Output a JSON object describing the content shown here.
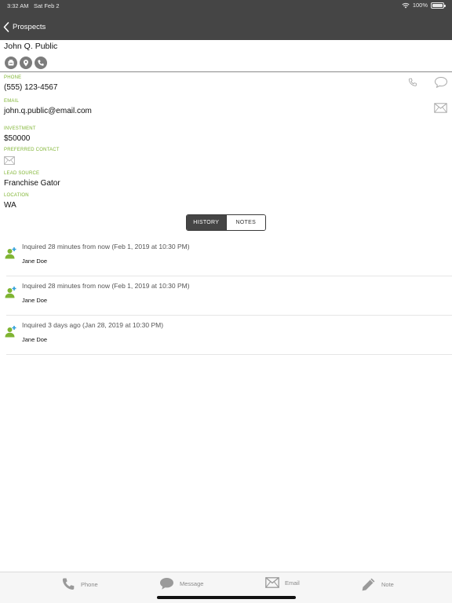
{
  "status_bar": {
    "time": "3:32 AM",
    "date": "Sat Feb 2",
    "battery": "100%",
    "battery_level": 1.0
  },
  "nav": {
    "back_label": "Prospects"
  },
  "contact": {
    "name": "John Q. Public",
    "fields": [
      {
        "label": "PHONE",
        "value": "(555) 123-4567"
      },
      {
        "label": "EMAIL",
        "value": "john.q.public@email.com"
      },
      {
        "label": "INVESTMENT",
        "value": "$50000"
      },
      {
        "label": "PREFERRED CONTACT",
        "icon": "envelope-icon"
      },
      {
        "label": "LEAD SOURCE",
        "value": "Franchise Gator"
      },
      {
        "label": "LOCATION",
        "value": "WA"
      }
    ]
  },
  "segments": {
    "history": "HISTORY",
    "notes": "NOTES",
    "selected": "HISTORY"
  },
  "history": [
    {
      "text": "Inquired 28 minutes from now (Feb 1, 2019 at 10:30 PM)",
      "person": "Jane Doe",
      "icon": "add-person-icon"
    },
    {
      "text": "Inquired 28 minutes from now (Feb 1, 2019 at 10:30 PM)",
      "person": "Jane Doe",
      "icon": "add-person-icon"
    },
    {
      "text": "Inquired 3 days ago (Jan 28, 2019 at 10:30 PM)",
      "person": "Jane Doe",
      "icon": "add-person-icon"
    }
  ],
  "tabbar": {
    "phone": "Phone",
    "message": "Message",
    "email": "Email",
    "note": "Note"
  },
  "colors": {
    "header": "#454545",
    "accent_green": "#7fb432",
    "icon_gray": "#7c7c7c"
  }
}
